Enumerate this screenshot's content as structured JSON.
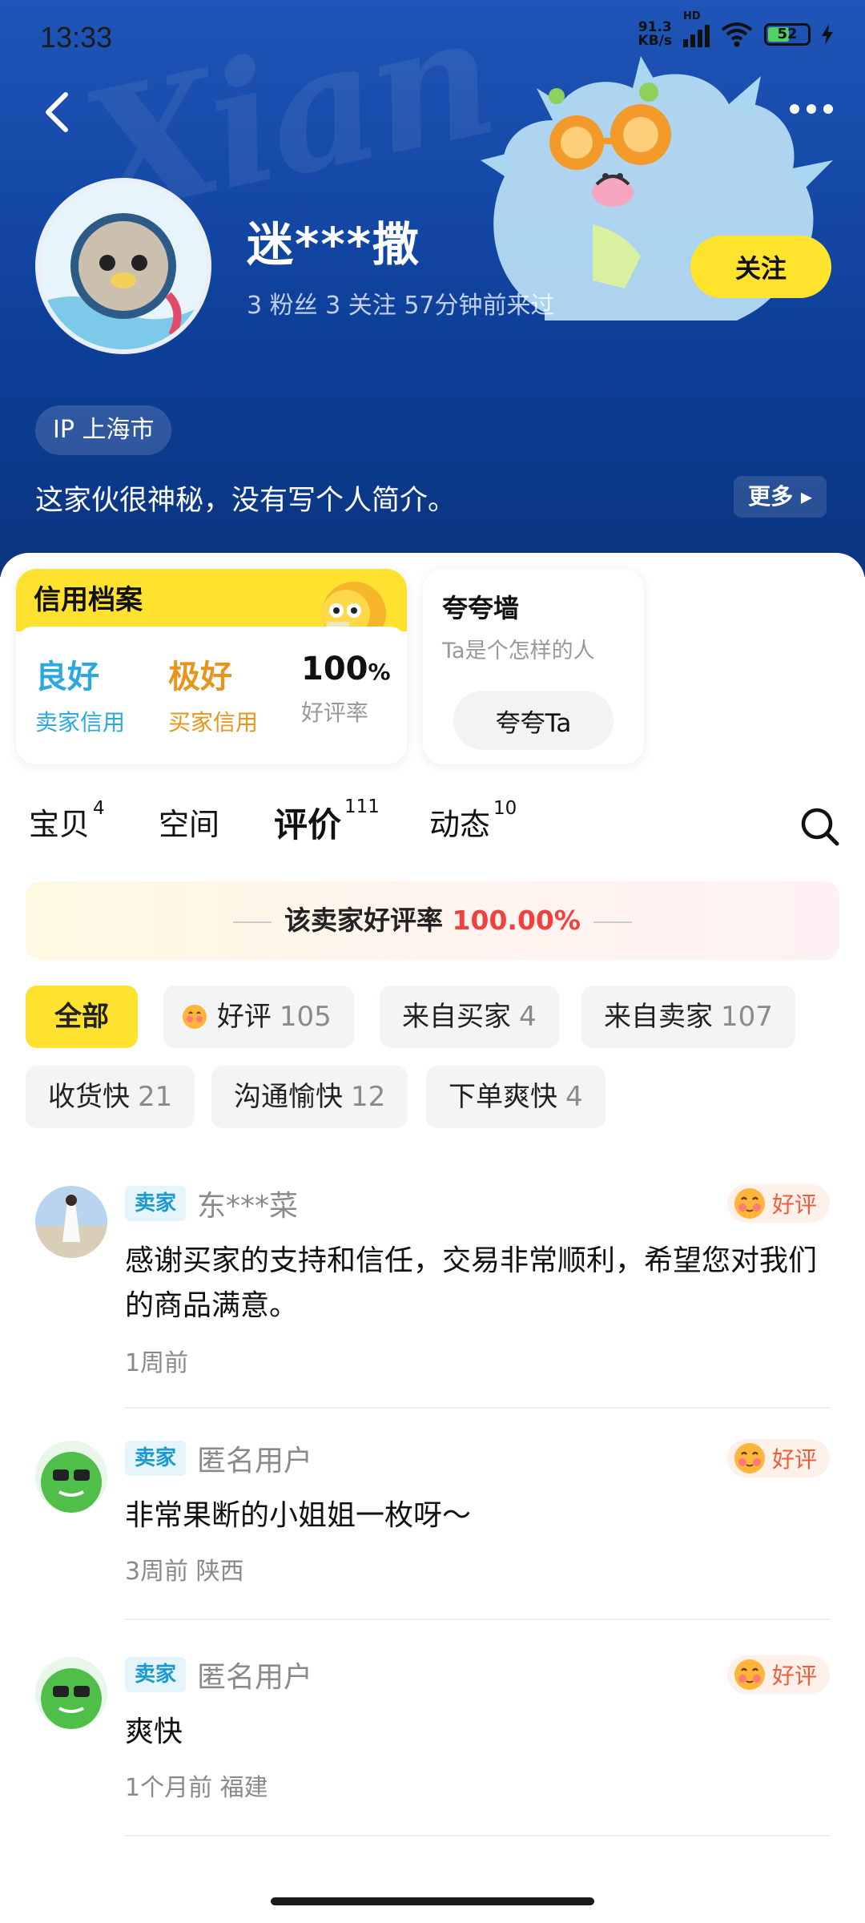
{
  "status_bar": {
    "time": "13:33",
    "net_speed_top": "91.3",
    "net_speed_bottom": "KB/s",
    "hd": "HD",
    "battery": "52"
  },
  "header": {
    "watermark": "Xian",
    "username": "迷***撒",
    "stats": "3 粉丝   3 关注   57分钟前来过",
    "follow_label": "关注",
    "ip_label": "IP 上海市",
    "bio": "这家伙很神秘，没有写个人简介。",
    "more_label": "更多"
  },
  "credit": {
    "title": "信用档案",
    "seller_value": "良好",
    "seller_label": "卖家信用",
    "buyer_value": "极好",
    "buyer_label": "买家信用",
    "rate_value": "100",
    "rate_unit": "%",
    "rate_label": "好评率"
  },
  "praise_wall": {
    "title": "夸夸墙",
    "subtitle": "Ta是个怎样的人",
    "button": "夸夸Ta"
  },
  "tabs": [
    {
      "label": "宝贝",
      "count": "4"
    },
    {
      "label": "空间",
      "count": ""
    },
    {
      "label": "评价",
      "count": "111"
    },
    {
      "label": "动态",
      "count": "10"
    }
  ],
  "rate_banner": {
    "prefix": "该卖家好评率",
    "value": "100.00%"
  },
  "filters": [
    {
      "label": "全部",
      "count": ""
    },
    {
      "label": "好评",
      "count": "105"
    },
    {
      "label": "来自买家",
      "count": "4"
    },
    {
      "label": "来自卖家",
      "count": "107"
    },
    {
      "label": "收货快",
      "count": "21"
    },
    {
      "label": "沟通愉快",
      "count": "12"
    },
    {
      "label": "下单爽快",
      "count": "4"
    }
  ],
  "reviews": [
    {
      "badge": "卖家",
      "name": "东***菜",
      "rating": "好评",
      "text": "感谢买家的支持和信任，交易非常顺利，希望您对我们的商品满意。",
      "meta": "1周前"
    },
    {
      "badge": "卖家",
      "name": "匿名用户",
      "rating": "好评",
      "text": "非常果断的小姐姐一枚呀～",
      "meta": "3周前  陕西"
    },
    {
      "badge": "卖家",
      "name": "匿名用户",
      "rating": "好评",
      "text": "爽快",
      "meta": "1个月前  福建"
    }
  ],
  "colors": {
    "accent_yellow": "#ffe12f",
    "header_blue": "#0d3f98",
    "seller_blue": "#2aa8df",
    "buyer_orange": "#e7951d",
    "rate_red": "#f0413e"
  }
}
